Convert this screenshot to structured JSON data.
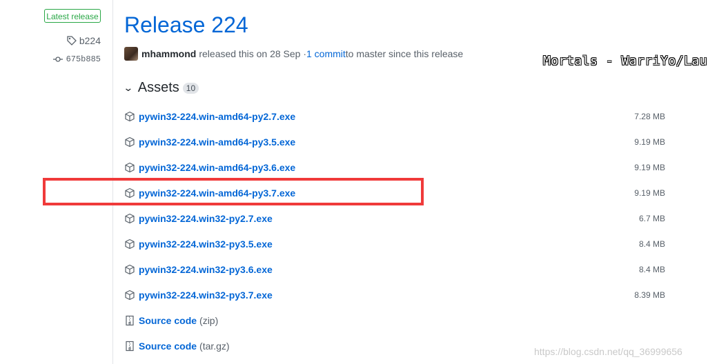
{
  "sidebar": {
    "badge": "Latest release",
    "tag": "b224",
    "commit": "675b885"
  },
  "release": {
    "title": "Release 224",
    "author": "mhammond",
    "meta_text": "released this on 28 Sep · ",
    "commits_link": "1 commit",
    "meta_suffix": " to master since this release"
  },
  "assets": {
    "label": "Assets",
    "count": "10",
    "items": [
      {
        "name": "pywin32-224.win-amd64-py2.7.exe",
        "size": "7.28 MB",
        "icon": "package-icon"
      },
      {
        "name": "pywin32-224.win-amd64-py3.5.exe",
        "size": "9.19 MB",
        "icon": "package-icon"
      },
      {
        "name": "pywin32-224.win-amd64-py3.6.exe",
        "size": "9.19 MB",
        "icon": "package-icon"
      },
      {
        "name": "pywin32-224.win-amd64-py3.7.exe",
        "size": "9.19 MB",
        "icon": "package-icon"
      },
      {
        "name": "pywin32-224.win32-py2.7.exe",
        "size": "6.7 MB",
        "icon": "package-icon"
      },
      {
        "name": "pywin32-224.win32-py3.5.exe",
        "size": "8.4 MB",
        "icon": "package-icon"
      },
      {
        "name": "pywin32-224.win32-py3.6.exe",
        "size": "8.4 MB",
        "icon": "package-icon"
      },
      {
        "name": "pywin32-224.win32-py3.7.exe",
        "size": "8.39 MB",
        "icon": "package-icon"
      }
    ],
    "source": [
      {
        "name": "Source code",
        "format": "(zip)",
        "icon": "file-zip-icon"
      },
      {
        "name": "Source code",
        "format": "(tar.gz)",
        "icon": "file-zip-icon"
      }
    ]
  },
  "watermarks": {
    "top": "Mortals - WarriYo/Laura",
    "bottom": "https://blog.csdn.net/qq_36999656"
  },
  "colors": {
    "link": "#0366d6",
    "badge_green": "#28a745",
    "highlight_red": "#f03a3a"
  }
}
